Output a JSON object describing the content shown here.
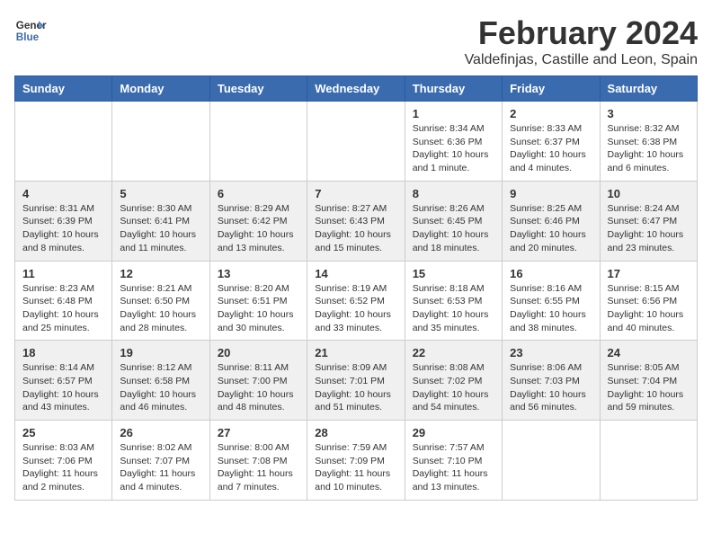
{
  "header": {
    "logo_general": "General",
    "logo_blue": "Blue",
    "month": "February 2024",
    "location": "Valdefinjas, Castille and Leon, Spain"
  },
  "days_of_week": [
    "Sunday",
    "Monday",
    "Tuesday",
    "Wednesday",
    "Thursday",
    "Friday",
    "Saturday"
  ],
  "weeks": [
    {
      "row_class": "odd-row",
      "days": [
        {
          "number": "",
          "info": ""
        },
        {
          "number": "",
          "info": ""
        },
        {
          "number": "",
          "info": ""
        },
        {
          "number": "",
          "info": ""
        },
        {
          "number": "1",
          "info": "Sunrise: 8:34 AM\nSunset: 6:36 PM\nDaylight: 10 hours and 1 minute."
        },
        {
          "number": "2",
          "info": "Sunrise: 8:33 AM\nSunset: 6:37 PM\nDaylight: 10 hours and 4 minutes."
        },
        {
          "number": "3",
          "info": "Sunrise: 8:32 AM\nSunset: 6:38 PM\nDaylight: 10 hours and 6 minutes."
        }
      ]
    },
    {
      "row_class": "even-row",
      "days": [
        {
          "number": "4",
          "info": "Sunrise: 8:31 AM\nSunset: 6:39 PM\nDaylight: 10 hours and 8 minutes."
        },
        {
          "number": "5",
          "info": "Sunrise: 8:30 AM\nSunset: 6:41 PM\nDaylight: 10 hours and 11 minutes."
        },
        {
          "number": "6",
          "info": "Sunrise: 8:29 AM\nSunset: 6:42 PM\nDaylight: 10 hours and 13 minutes."
        },
        {
          "number": "7",
          "info": "Sunrise: 8:27 AM\nSunset: 6:43 PM\nDaylight: 10 hours and 15 minutes."
        },
        {
          "number": "8",
          "info": "Sunrise: 8:26 AM\nSunset: 6:45 PM\nDaylight: 10 hours and 18 minutes."
        },
        {
          "number": "9",
          "info": "Sunrise: 8:25 AM\nSunset: 6:46 PM\nDaylight: 10 hours and 20 minutes."
        },
        {
          "number": "10",
          "info": "Sunrise: 8:24 AM\nSunset: 6:47 PM\nDaylight: 10 hours and 23 minutes."
        }
      ]
    },
    {
      "row_class": "odd-row",
      "days": [
        {
          "number": "11",
          "info": "Sunrise: 8:23 AM\nSunset: 6:48 PM\nDaylight: 10 hours and 25 minutes."
        },
        {
          "number": "12",
          "info": "Sunrise: 8:21 AM\nSunset: 6:50 PM\nDaylight: 10 hours and 28 minutes."
        },
        {
          "number": "13",
          "info": "Sunrise: 8:20 AM\nSunset: 6:51 PM\nDaylight: 10 hours and 30 minutes."
        },
        {
          "number": "14",
          "info": "Sunrise: 8:19 AM\nSunset: 6:52 PM\nDaylight: 10 hours and 33 minutes."
        },
        {
          "number": "15",
          "info": "Sunrise: 8:18 AM\nSunset: 6:53 PM\nDaylight: 10 hours and 35 minutes."
        },
        {
          "number": "16",
          "info": "Sunrise: 8:16 AM\nSunset: 6:55 PM\nDaylight: 10 hours and 38 minutes."
        },
        {
          "number": "17",
          "info": "Sunrise: 8:15 AM\nSunset: 6:56 PM\nDaylight: 10 hours and 40 minutes."
        }
      ]
    },
    {
      "row_class": "even-row",
      "days": [
        {
          "number": "18",
          "info": "Sunrise: 8:14 AM\nSunset: 6:57 PM\nDaylight: 10 hours and 43 minutes."
        },
        {
          "number": "19",
          "info": "Sunrise: 8:12 AM\nSunset: 6:58 PM\nDaylight: 10 hours and 46 minutes."
        },
        {
          "number": "20",
          "info": "Sunrise: 8:11 AM\nSunset: 7:00 PM\nDaylight: 10 hours and 48 minutes."
        },
        {
          "number": "21",
          "info": "Sunrise: 8:09 AM\nSunset: 7:01 PM\nDaylight: 10 hours and 51 minutes."
        },
        {
          "number": "22",
          "info": "Sunrise: 8:08 AM\nSunset: 7:02 PM\nDaylight: 10 hours and 54 minutes."
        },
        {
          "number": "23",
          "info": "Sunrise: 8:06 AM\nSunset: 7:03 PM\nDaylight: 10 hours and 56 minutes."
        },
        {
          "number": "24",
          "info": "Sunrise: 8:05 AM\nSunset: 7:04 PM\nDaylight: 10 hours and 59 minutes."
        }
      ]
    },
    {
      "row_class": "odd-row",
      "days": [
        {
          "number": "25",
          "info": "Sunrise: 8:03 AM\nSunset: 7:06 PM\nDaylight: 11 hours and 2 minutes."
        },
        {
          "number": "26",
          "info": "Sunrise: 8:02 AM\nSunset: 7:07 PM\nDaylight: 11 hours and 4 minutes."
        },
        {
          "number": "27",
          "info": "Sunrise: 8:00 AM\nSunset: 7:08 PM\nDaylight: 11 hours and 7 minutes."
        },
        {
          "number": "28",
          "info": "Sunrise: 7:59 AM\nSunset: 7:09 PM\nDaylight: 11 hours and 10 minutes."
        },
        {
          "number": "29",
          "info": "Sunrise: 7:57 AM\nSunset: 7:10 PM\nDaylight: 11 hours and 13 minutes."
        },
        {
          "number": "",
          "info": ""
        },
        {
          "number": "",
          "info": ""
        }
      ]
    }
  ]
}
